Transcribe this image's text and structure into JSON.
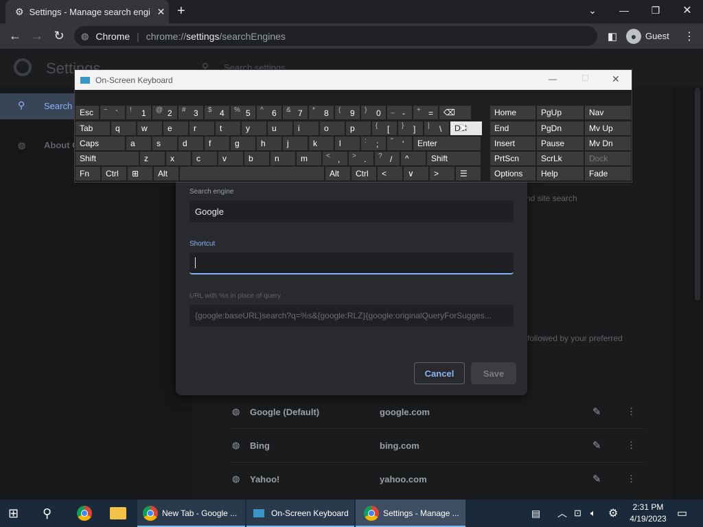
{
  "browser": {
    "tab_title": "Settings - Manage search engine",
    "omnibox_site": "Chrome",
    "omnibox_url_prefix": "chrome://",
    "omnibox_url_bold": "settings",
    "omnibox_url_rest": "/searchEngines",
    "profile_label": "Guest"
  },
  "settings": {
    "title": "Settings",
    "search_placeholder": "Search settings",
    "sidebar_search": "Search",
    "sidebar_about": "About C",
    "bg_text_1": "nd site search",
    "bg_text_2": "followed by your preferred",
    "engines": [
      {
        "name": "Google (Default)",
        "url": "google.com"
      },
      {
        "name": "Bing",
        "url": "bing.com"
      },
      {
        "name": "Yahoo!",
        "url": "yahoo.com"
      }
    ]
  },
  "dialog": {
    "engine_label": "Search engine",
    "engine_value": "Google",
    "shortcut_label": "Shortcut",
    "shortcut_value": "",
    "url_label": "URL with %s in place of query",
    "url_value": "{google:baseURL}search?q=%s&{google:RLZ}{google:originalQueryForSugges...",
    "cancel": "Cancel",
    "save": "Save"
  },
  "osk": {
    "title": "On-Screen Keyboard",
    "rows": {
      "r1": [
        {
          "m": "Esc"
        },
        {
          "s": "~",
          "b": "`"
        },
        {
          "s": "!",
          "b": "1"
        },
        {
          "s": "@",
          "b": "2"
        },
        {
          "s": "#",
          "b": "3"
        },
        {
          "s": "$",
          "b": "4"
        },
        {
          "s": "%",
          "b": "5"
        },
        {
          "s": "^",
          "b": "6"
        },
        {
          "s": "&",
          "b": "7"
        },
        {
          "s": "*",
          "b": "8"
        },
        {
          "s": "(",
          "b": "9"
        },
        {
          "s": ")",
          "b": "0"
        },
        {
          "s": "_",
          "b": "-"
        },
        {
          "s": "+",
          "b": "="
        },
        {
          "m": "⌫"
        }
      ],
      "r2": [
        {
          "m": "Tab"
        },
        {
          "m": "q"
        },
        {
          "m": "w"
        },
        {
          "m": "e"
        },
        {
          "m": "r"
        },
        {
          "m": "t"
        },
        {
          "m": "y"
        },
        {
          "m": "u"
        },
        {
          "m": "i"
        },
        {
          "m": "o"
        },
        {
          "m": "p"
        },
        {
          "s": "{",
          "b": "["
        },
        {
          "s": "}",
          "b": "]"
        },
        {
          "s": "|",
          "b": "\\"
        },
        {
          "m": "Del"
        }
      ],
      "r3": [
        {
          "m": "Caps"
        },
        {
          "m": "a"
        },
        {
          "m": "s"
        },
        {
          "m": "d"
        },
        {
          "m": "f"
        },
        {
          "m": "g"
        },
        {
          "m": "h"
        },
        {
          "m": "j"
        },
        {
          "m": "k"
        },
        {
          "m": "l"
        },
        {
          "s": ":",
          "b": ";"
        },
        {
          "s": "\"",
          "b": "'"
        },
        {
          "m": "Enter"
        }
      ],
      "r4": [
        {
          "m": "Shift"
        },
        {
          "m": "z"
        },
        {
          "m": "x"
        },
        {
          "m": "c"
        },
        {
          "m": "v"
        },
        {
          "m": "b"
        },
        {
          "m": "n"
        },
        {
          "m": "m"
        },
        {
          "s": "<",
          "b": ","
        },
        {
          "s": ">",
          "b": "."
        },
        {
          "s": "?",
          "b": "/"
        },
        {
          "m": "^"
        },
        {
          "m": "Shift"
        }
      ],
      "r5": [
        {
          "m": "Fn"
        },
        {
          "m": "Ctrl"
        },
        {
          "m": "⊞"
        },
        {
          "m": "Alt"
        },
        {
          "m": ""
        },
        {
          "m": "Alt"
        },
        {
          "m": "Ctrl"
        },
        {
          "m": "<"
        },
        {
          "m": "∨"
        },
        {
          "m": ">"
        },
        {
          "m": "☰"
        }
      ]
    },
    "nav": [
      [
        "Home",
        "PgUp",
        "Nav"
      ],
      [
        "End",
        "PgDn",
        "Mv Up"
      ],
      [
        "Insert",
        "Pause",
        "Mv Dn"
      ],
      [
        "PrtScn",
        "ScrLk",
        "Dock"
      ],
      [
        "Options",
        "Help",
        "Fade"
      ]
    ]
  },
  "taskbar": {
    "item1": "New Tab - Google ...",
    "item2": "On-Screen Keyboard",
    "item3": "Settings - Manage ...",
    "time": "2:31 PM",
    "date": "4/19/2023"
  },
  "colors": {
    "accent": "#8ab4f8",
    "taskbar": "#1b2a3a"
  }
}
